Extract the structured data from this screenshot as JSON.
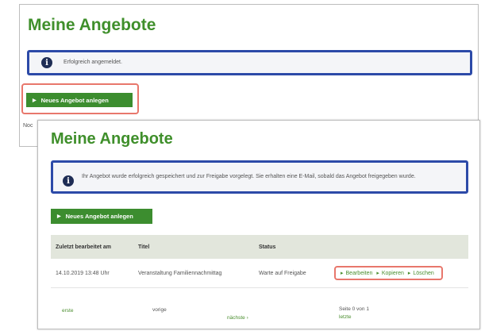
{
  "screen1": {
    "title": "Meine Angebote",
    "info_message": "Erfolgreich angemeldet.",
    "new_offer_button": "Neues Angebot anlegen",
    "truncated_text": "Noc"
  },
  "screen2": {
    "title": "Meine Angebote",
    "info_message": "Ihr Angebot wurde erfolgreich gespeichert und zur Freigabe vorgelegt. Sie erhalten eine E-Mail, sobald das Angebot freigegeben wurde.",
    "new_offer_button": "Neues Angebot anlegen",
    "table": {
      "headers": [
        "Zuletzt bearbeitet am",
        "Titel",
        "Status",
        ""
      ],
      "rows": [
        {
          "date": "14.10.2019 13:48 Uhr",
          "title": "Veranstaltung Familiennachmittag",
          "status": "Warte auf Freigabe",
          "actions": [
            "Bearbeiten",
            "Kopieren",
            "Löschen"
          ]
        }
      ]
    },
    "pager": {
      "first": "erste",
      "prev": "vorige",
      "next": "nächste",
      "page_info": "Seite 0 von 1",
      "last": "letzte"
    }
  },
  "colors": {
    "title_green": "#3f8f2b",
    "button_green": "#3c8d2f",
    "info_border_blue": "#2c4aa8",
    "highlight_red": "#e8776c"
  }
}
